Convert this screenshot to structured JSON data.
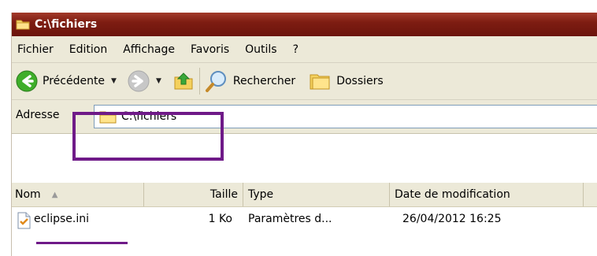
{
  "window": {
    "title": "C:\\fichiers"
  },
  "menu": [
    "Fichier",
    "Edition",
    "Affichage",
    "Favoris",
    "Outils",
    "?"
  ],
  "toolbar": {
    "back_label": "Précédente",
    "search_label": "Rechercher",
    "folders_label": "Dossiers"
  },
  "address": {
    "label": "Adresse",
    "value": "C:\\fichiers"
  },
  "columns": {
    "name": "Nom",
    "size": "Taille",
    "type": "Type",
    "date": "Date de modification"
  },
  "files": [
    {
      "name": "eclipse.ini",
      "size": "1 Ko",
      "type": "Paramètres d...",
      "date": "26/04/2012 16:25"
    }
  ],
  "colors": {
    "titlebar": "#7e1d12",
    "annotation": "#6f1a88"
  }
}
